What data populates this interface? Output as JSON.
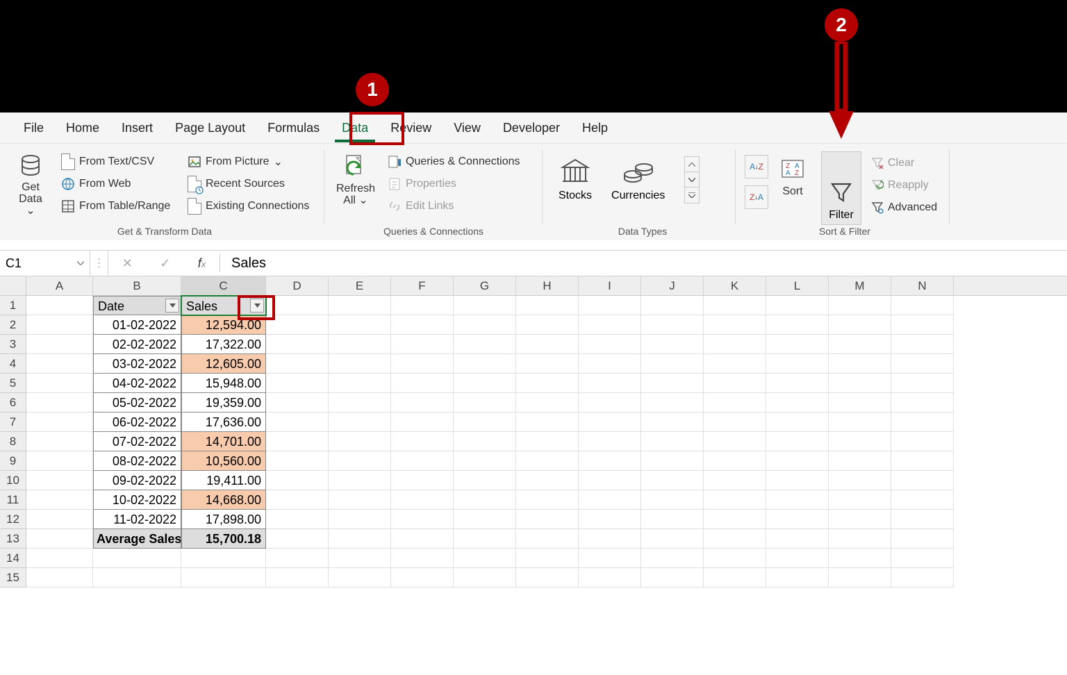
{
  "tabs": {
    "file": "File",
    "home": "Home",
    "insert": "Insert",
    "layout": "Page Layout",
    "formulas": "Formulas",
    "data": "Data",
    "review": "Review",
    "view": "View",
    "developer": "Developer",
    "help": "Help"
  },
  "ribbon": {
    "getdata": "Get\nData",
    "caret": "⌄",
    "fromtext": "From Text/CSV",
    "fromweb": "From Web",
    "fromtable": "From Table/Range",
    "frompicture": "From Picture",
    "recent": "Recent Sources",
    "existing": "Existing Connections",
    "group1": "Get & Transform Data",
    "refresh": "Refresh\nAll",
    "queries": "Queries & Connections",
    "properties": "Properties",
    "editlinks": "Edit Links",
    "group2": "Queries & Connections",
    "stocks": "Stocks",
    "currencies": "Currencies",
    "group3": "Data Types",
    "sort": "Sort",
    "filter": "Filter",
    "clear": "Clear",
    "reapply": "Reapply",
    "advanced": "Advanced",
    "group4": "Sort & Filter"
  },
  "formulabar": {
    "cell": "C1",
    "value": "Sales",
    "fx": "f",
    "fxsub": "x"
  },
  "columns": [
    "A",
    "B",
    "C",
    "D",
    "E",
    "F",
    "G",
    "H",
    "I",
    "J",
    "K",
    "L",
    "M",
    "N"
  ],
  "headers": {
    "date": "Date",
    "sales": "Sales"
  },
  "rows": [
    {
      "n": "1"
    },
    {
      "n": "2",
      "date": "01-02-2022",
      "sales": "12,594.00",
      "hl": true
    },
    {
      "n": "3",
      "date": "02-02-2022",
      "sales": "17,322.00",
      "hl": false
    },
    {
      "n": "4",
      "date": "03-02-2022",
      "sales": "12,605.00",
      "hl": true
    },
    {
      "n": "5",
      "date": "04-02-2022",
      "sales": "15,948.00",
      "hl": false
    },
    {
      "n": "6",
      "date": "05-02-2022",
      "sales": "19,359.00",
      "hl": false
    },
    {
      "n": "7",
      "date": "06-02-2022",
      "sales": "17,636.00",
      "hl": false
    },
    {
      "n": "8",
      "date": "07-02-2022",
      "sales": "14,701.00",
      "hl": true
    },
    {
      "n": "9",
      "date": "08-02-2022",
      "sales": "10,560.00",
      "hl": true
    },
    {
      "n": "10",
      "date": "09-02-2022",
      "sales": "19,411.00",
      "hl": false
    },
    {
      "n": "11",
      "date": "10-02-2022",
      "sales": "14,668.00",
      "hl": true
    },
    {
      "n": "12",
      "date": "11-02-2022",
      "sales": "17,898.00",
      "hl": false
    },
    {
      "n": "13",
      "avg_label": "Average Sales",
      "avg_val": "15,700.18"
    },
    {
      "n": "14"
    },
    {
      "n": "15"
    }
  ],
  "callouts": {
    "one": "1",
    "two": "2"
  }
}
